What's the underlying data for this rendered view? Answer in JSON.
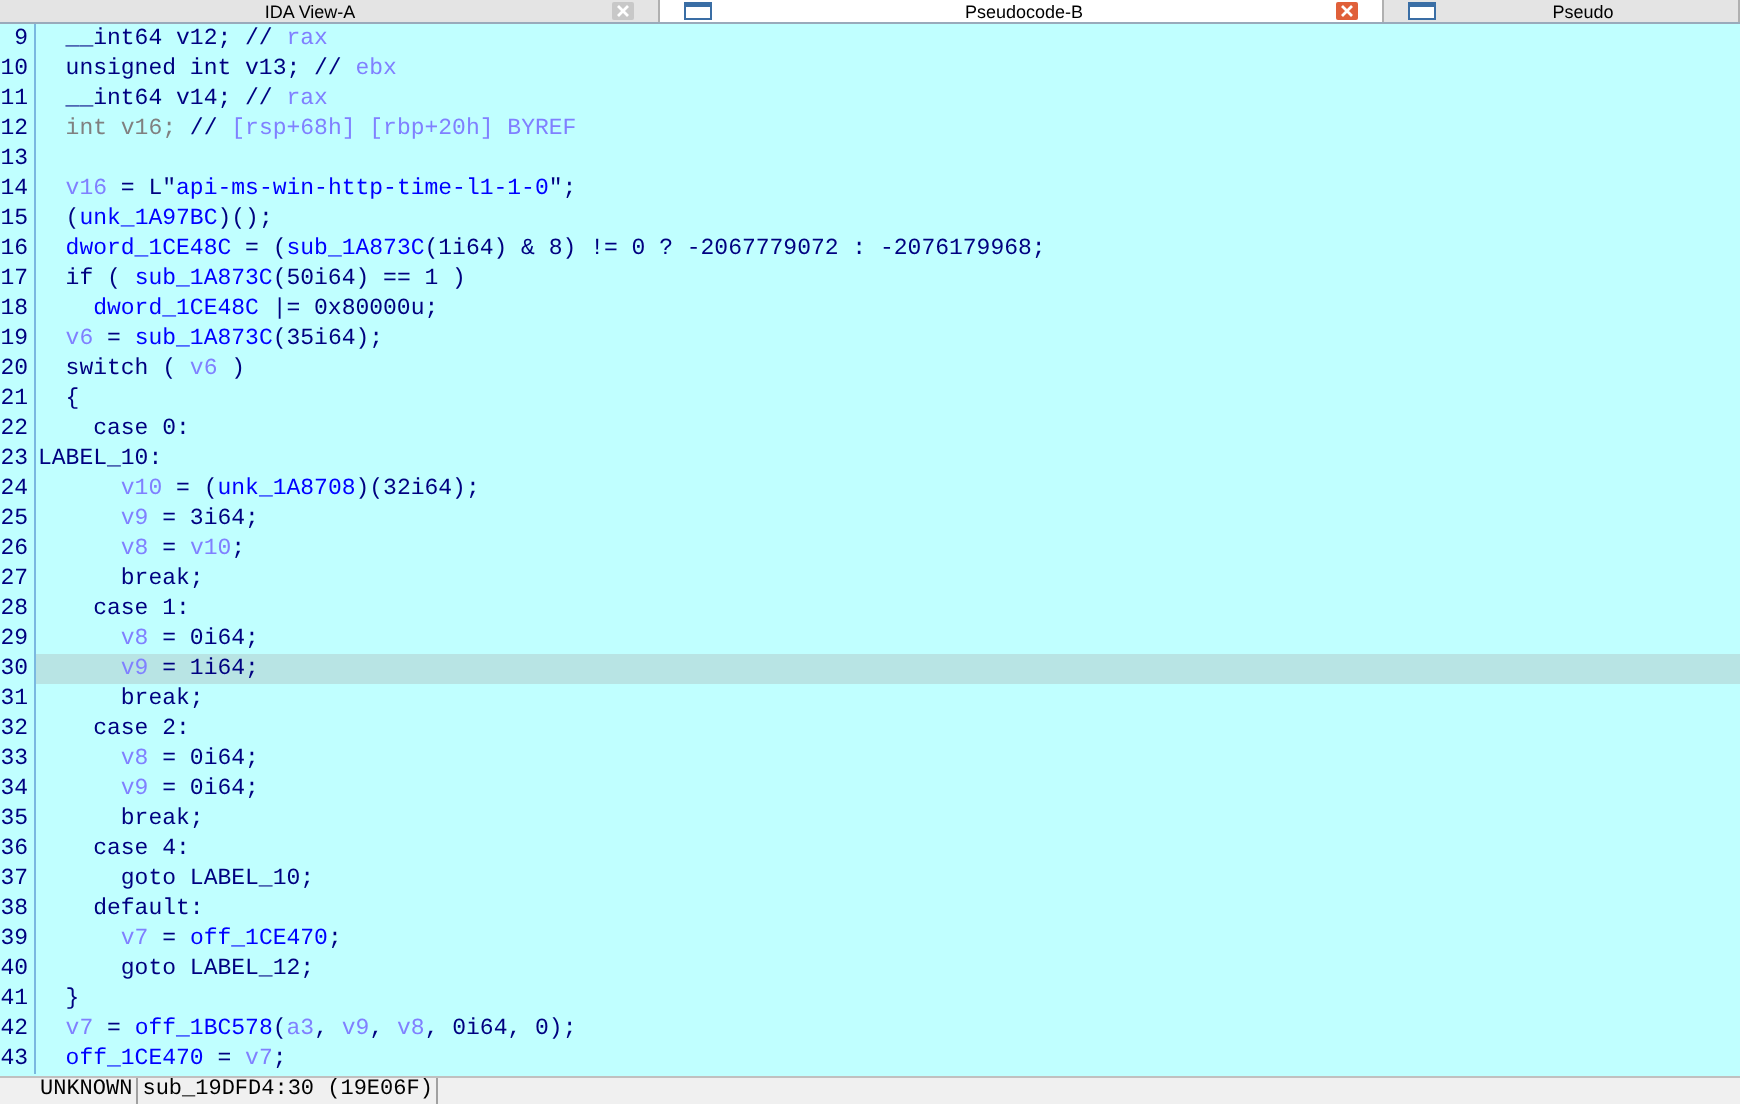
{
  "tabs": [
    {
      "label": "IDA View-A",
      "selected": false
    },
    {
      "label": "Pseudocode-B",
      "selected": true
    },
    {
      "label": "Pseudo",
      "selected": false
    }
  ],
  "code": {
    "lines": [
      {
        "number": "9",
        "selected": false,
        "tokens": [
          {
            "kind": "text",
            "text": "  __int64 v12; // "
          },
          {
            "kind": "comment",
            "text": "rax"
          }
        ]
      },
      {
        "number": "10",
        "selected": false,
        "tokens": [
          {
            "kind": "text",
            "text": "  unsigned int v13; // "
          },
          {
            "kind": "comment",
            "text": "ebx"
          }
        ]
      },
      {
        "number": "11",
        "selected": false,
        "tokens": [
          {
            "kind": "text",
            "text": "  __int64 v14; // "
          },
          {
            "kind": "comment",
            "text": "rax"
          }
        ]
      },
      {
        "number": "12",
        "selected": false,
        "tokens": [
          {
            "kind": "dim",
            "text": "  int v16; "
          },
          {
            "kind": "text",
            "text": "// "
          },
          {
            "kind": "comment",
            "text": "[rsp+68h] [rbp+20h] BYREF"
          }
        ]
      },
      {
        "number": "13",
        "selected": false
      },
      {
        "number": "14",
        "selected": false,
        "tokens": [
          {
            "kind": "var",
            "text": "  v16"
          },
          {
            "kind": "text",
            "text": " = L\""
          },
          {
            "kind": "name",
            "text": "api-ms-win-http-time-l1-1-0"
          },
          {
            "kind": "text",
            "text": "\";"
          }
        ]
      },
      {
        "number": "15",
        "selected": false,
        "tokens": [
          {
            "kind": "text",
            "text": "  ("
          },
          {
            "kind": "name",
            "text": "unk_1A97BC"
          },
          {
            "kind": "text",
            "text": ")();"
          }
        ]
      },
      {
        "number": "16",
        "selected": false,
        "tokens": [
          {
            "kind": "name",
            "text": "  dword_1CE48C"
          },
          {
            "kind": "text",
            "text": " = ("
          },
          {
            "kind": "name",
            "text": "sub_1A873C"
          },
          {
            "kind": "text",
            "text": "(1i64) & 8) != 0 ? -2067779072 : -2076179968;"
          }
        ]
      },
      {
        "number": "17",
        "selected": false,
        "tokens": [
          {
            "kind": "text",
            "text": "  if ( "
          },
          {
            "kind": "name",
            "text": "sub_1A873C"
          },
          {
            "kind": "text",
            "text": "(50i64) == 1 )"
          }
        ]
      },
      {
        "number": "18",
        "selected": false,
        "tokens": [
          {
            "kind": "name",
            "text": "    dword_1CE48C"
          },
          {
            "kind": "text",
            "text": " |= 0x80000u;"
          }
        ]
      },
      {
        "number": "19",
        "selected": false,
        "tokens": [
          {
            "kind": "var",
            "text": "  v6"
          },
          {
            "kind": "text",
            "text": " = "
          },
          {
            "kind": "name",
            "text": "sub_1A873C"
          },
          {
            "kind": "text",
            "text": "(35i64);"
          }
        ]
      },
      {
        "number": "20",
        "selected": false,
        "tokens": [
          {
            "kind": "text",
            "text": "  switch ( "
          },
          {
            "kind": "var",
            "text": "v6"
          },
          {
            "kind": "text",
            "text": " )"
          }
        ]
      },
      {
        "number": "21",
        "selected": false,
        "tokens": [
          {
            "kind": "text",
            "text": "  {"
          }
        ]
      },
      {
        "number": "22",
        "selected": false,
        "tokens": [
          {
            "kind": "text",
            "text": "    case 0:"
          }
        ]
      },
      {
        "number": "23",
        "selected": false,
        "tokens": [
          {
            "kind": "text",
            "text": "LABEL_10:"
          }
        ]
      },
      {
        "number": "24",
        "selected": false,
        "tokens": [
          {
            "kind": "var",
            "text": "      v10"
          },
          {
            "kind": "text",
            "text": " = ("
          },
          {
            "kind": "name",
            "text": "unk_1A8708"
          },
          {
            "kind": "text",
            "text": ")(32i64);"
          }
        ]
      },
      {
        "number": "25",
        "selected": false,
        "tokens": [
          {
            "kind": "var",
            "text": "      v9"
          },
          {
            "kind": "text",
            "text": " = 3i64;"
          }
        ]
      },
      {
        "number": "26",
        "selected": false,
        "tokens": [
          {
            "kind": "var",
            "text": "      v8"
          },
          {
            "kind": "text",
            "text": " = "
          },
          {
            "kind": "var",
            "text": "v10"
          },
          {
            "kind": "text",
            "text": ";"
          }
        ]
      },
      {
        "number": "27",
        "selected": false,
        "tokens": [
          {
            "kind": "text",
            "text": "      break;"
          }
        ]
      },
      {
        "number": "28",
        "selected": false,
        "tokens": [
          {
            "kind": "text",
            "text": "    case 1:"
          }
        ]
      },
      {
        "number": "29",
        "selected": false,
        "tokens": [
          {
            "kind": "var",
            "text": "      v8"
          },
          {
            "kind": "text",
            "text": " = 0i64;"
          }
        ]
      },
      {
        "number": "30",
        "selected": true,
        "tokens": [
          {
            "kind": "var",
            "text": "      v9"
          },
          {
            "kind": "text",
            "text": " = 1i64;"
          }
        ]
      },
      {
        "number": "31",
        "selected": false,
        "tokens": [
          {
            "kind": "text",
            "text": "      break;"
          }
        ]
      },
      {
        "number": "32",
        "selected": false,
        "tokens": [
          {
            "kind": "text",
            "text": "    case 2:"
          }
        ]
      },
      {
        "number": "33",
        "selected": false,
        "tokens": [
          {
            "kind": "var",
            "text": "      v8"
          },
          {
            "kind": "text",
            "text": " = 0i64;"
          }
        ]
      },
      {
        "number": "34",
        "selected": false,
        "tokens": [
          {
            "kind": "var",
            "text": "      v9"
          },
          {
            "kind": "text",
            "text": " = 0i64;"
          }
        ]
      },
      {
        "number": "35",
        "selected": false,
        "tokens": [
          {
            "kind": "text",
            "text": "      break;"
          }
        ]
      },
      {
        "number": "36",
        "selected": false,
        "tokens": [
          {
            "kind": "text",
            "text": "    case 4:"
          }
        ]
      },
      {
        "number": "37",
        "selected": false,
        "tokens": [
          {
            "kind": "text",
            "text": "      goto LABEL_10;"
          }
        ]
      },
      {
        "number": "38",
        "selected": false,
        "tokens": [
          {
            "kind": "text",
            "text": "    default:"
          }
        ]
      },
      {
        "number": "39",
        "selected": false,
        "tokens": [
          {
            "kind": "var",
            "text": "      v7"
          },
          {
            "kind": "text",
            "text": " = "
          },
          {
            "kind": "name",
            "text": "off_1CE470"
          },
          {
            "kind": "text",
            "text": ";"
          }
        ]
      },
      {
        "number": "40",
        "selected": false,
        "tokens": [
          {
            "kind": "text",
            "text": "      goto LABEL_12;"
          }
        ]
      },
      {
        "number": "41",
        "selected": false,
        "tokens": [
          {
            "kind": "text",
            "text": "  }"
          }
        ]
      },
      {
        "number": "42",
        "selected": false,
        "tokens": [
          {
            "kind": "var",
            "text": "  v7"
          },
          {
            "kind": "text",
            "text": " = "
          },
          {
            "kind": "name",
            "text": "off_1BC578"
          },
          {
            "kind": "text",
            "text": "("
          },
          {
            "kind": "var",
            "text": "a3"
          },
          {
            "kind": "text",
            "text": ", "
          },
          {
            "kind": "var",
            "text": "v9"
          },
          {
            "kind": "text",
            "text": ", "
          },
          {
            "kind": "var",
            "text": "v8"
          },
          {
            "kind": "text",
            "text": ", 0i64, 0);"
          }
        ]
      },
      {
        "number": "43",
        "selected": false,
        "tokens": [
          {
            "kind": "name",
            "text": "  off_1CE470"
          },
          {
            "kind": "text",
            "text": " = "
          },
          {
            "kind": "var",
            "text": "v7"
          },
          {
            "kind": "text",
            "text": ";"
          }
        ]
      }
    ]
  },
  "status_bar": [
    "UNKNOWN",
    "sub_19DFD4:30 (19E06F)"
  ]
}
